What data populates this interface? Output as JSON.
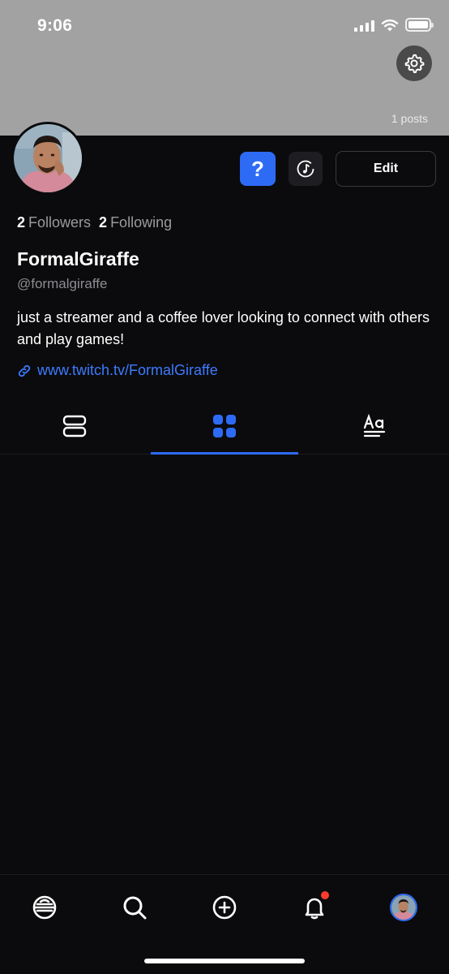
{
  "status_bar": {
    "time": "9:06"
  },
  "banner": {
    "posts_count": "1 posts"
  },
  "actions": {
    "help_label": "?",
    "edit_label": "Edit"
  },
  "stats": {
    "followers_count": "2",
    "followers_label": "Followers",
    "following_count": "2",
    "following_label": "Following"
  },
  "profile": {
    "display_name": "FormalGiraffe",
    "handle": "@formalgiraffe",
    "bio": "just a streamer and a coffee lover looking to connect with others and play games!",
    "link": "www.twitch.tv/FormalGiraffe"
  },
  "tabs": [
    {
      "icon": "list-view-icon",
      "active": false
    },
    {
      "icon": "grid-view-icon",
      "active": true
    },
    {
      "icon": "text-posts-icon",
      "active": false
    }
  ],
  "bottom_nav": [
    {
      "icon": "home-icon"
    },
    {
      "icon": "search-icon"
    },
    {
      "icon": "create-post-icon"
    },
    {
      "icon": "notifications-icon",
      "badge": true
    },
    {
      "icon": "profile-avatar"
    }
  ],
  "colors": {
    "accent": "#2e6bf5",
    "link": "#3d7bff",
    "background": "#0b0b0d",
    "banner": "#a2a2a2",
    "notification_badge": "#ff3b30"
  }
}
